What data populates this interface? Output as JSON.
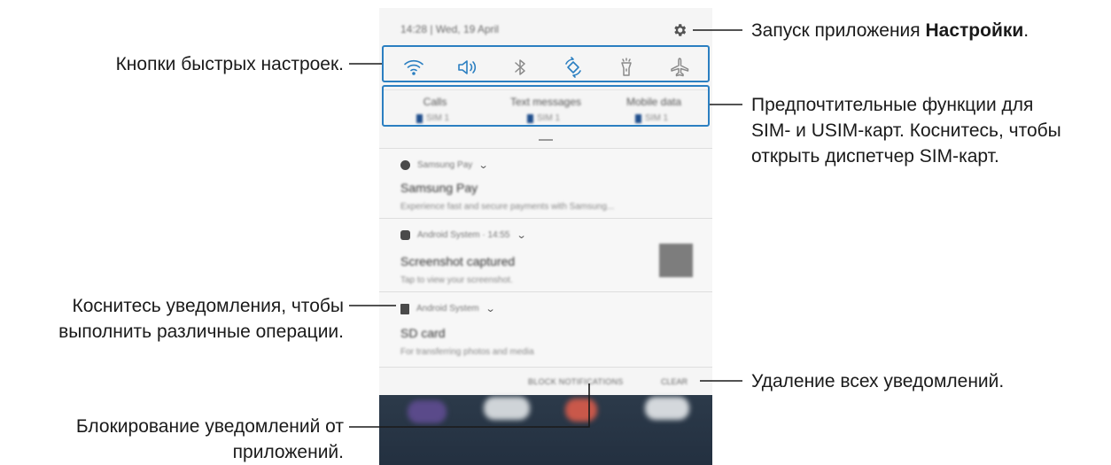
{
  "status_bar": {
    "time_date": "14:28 | Wed, 19 April",
    "settings_icon": "gear-icon"
  },
  "quick_settings": [
    {
      "name": "qs-wifi",
      "icon": "wifi-icon"
    },
    {
      "name": "qs-sound",
      "icon": "sound-icon"
    },
    {
      "name": "qs-bluetooth",
      "icon": "bluetooth-icon"
    },
    {
      "name": "qs-autorotate",
      "icon": "rotate-icon"
    },
    {
      "name": "qs-flashlight",
      "icon": "flashlight-icon"
    },
    {
      "name": "qs-airplane",
      "icon": "airplane-icon"
    }
  ],
  "sim_preferences": [
    {
      "title": "Calls",
      "sim": "SIM 1"
    },
    {
      "title": "Text messages",
      "sim": "SIM 1"
    },
    {
      "title": "Mobile data",
      "sim": "SIM 1"
    }
  ],
  "notifications": [
    {
      "app": "Samsung Pay",
      "title": "Samsung Pay",
      "body": "Experience fast and secure payments with Samsung..."
    },
    {
      "app": "Android System · 14:55",
      "title": "Screenshot captured",
      "body": "Tap to view your screenshot."
    },
    {
      "app": "Android System",
      "title": "SD card",
      "body": "For transferring photos and media"
    }
  ],
  "actions": {
    "block": "BLOCK NOTIFICATIONS",
    "clear": "CLEAR"
  },
  "callouts": {
    "settings_prefix": "Запуск приложения ",
    "settings_bold": "Настройки",
    "settings_suffix": ".",
    "quick_buttons": "Кнопки быстрых настроек.",
    "sim_line1": "Предпочтительные функции для",
    "sim_line2": "SIM- и USIM-карт. Коснитесь, чтобы",
    "sim_line3": "открыть диспетчер SIM-карт.",
    "notif_line1": "Коснитесь уведомления, чтобы",
    "notif_line2": "выполнить различные операции.",
    "clear_all": "Удаление всех уведомлений.",
    "block_line1": "Блокирование уведомлений от",
    "block_line2": "приложений."
  },
  "colors": {
    "accent": "#2b7fc1",
    "icon": "#2b7fc1",
    "home_bg": "#2c3a4a"
  }
}
